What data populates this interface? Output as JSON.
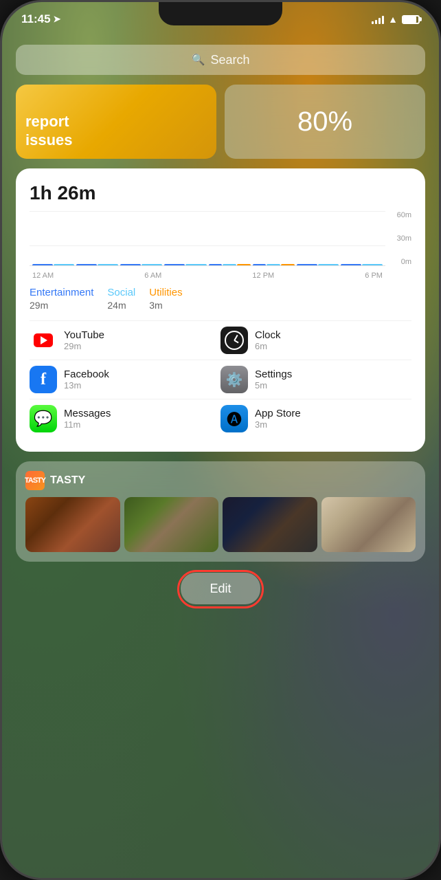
{
  "phone": {
    "time": "11:45",
    "status_bar": {
      "signal_bars": [
        3,
        4,
        5,
        6
      ],
      "battery_percent": 85
    }
  },
  "search_bar": {
    "placeholder": "Search",
    "icon": "search-icon"
  },
  "widgets": {
    "issues": {
      "label": "report\nissues"
    },
    "battery": {
      "value": "80%"
    }
  },
  "screen_time": {
    "total": "1h 26m",
    "chart": {
      "y_labels": [
        "60m",
        "30m",
        "0m"
      ],
      "x_labels": [
        "12 AM",
        "6 AM",
        "12 PM",
        "6 PM"
      ],
      "bars": [
        {
          "height_ent": 0,
          "height_soc": 0,
          "height_util": 0
        },
        {
          "height_ent": 0,
          "height_soc": 0,
          "height_util": 0
        },
        {
          "height_ent": 15,
          "height_soc": 8,
          "height_util": 0
        },
        {
          "height_ent": 25,
          "height_soc": 20,
          "height_util": 0
        },
        {
          "height_ent": 30,
          "height_soc": 18,
          "height_util": 5
        },
        {
          "height_ent": 35,
          "height_soc": 22,
          "height_util": 3
        },
        {
          "height_ent": 20,
          "height_soc": 15,
          "height_util": 0
        },
        {
          "height_ent": 0,
          "height_soc": 0,
          "height_util": 0
        }
      ]
    },
    "categories": [
      {
        "name": "Entertainment",
        "color": "#3478f6",
        "time": "29m"
      },
      {
        "name": "Social",
        "color": "#5ac8fa",
        "time": "24m"
      },
      {
        "name": "Utilities",
        "color": "#ff9500",
        "time": "3m"
      }
    ],
    "apps": [
      {
        "name": "YouTube",
        "time": "29m",
        "icon_type": "youtube",
        "position": "left"
      },
      {
        "name": "Clock",
        "time": "6m",
        "icon_type": "clock",
        "position": "right"
      },
      {
        "name": "Facebook",
        "time": "13m",
        "icon_type": "facebook",
        "position": "left"
      },
      {
        "name": "Settings",
        "time": "5m",
        "icon_type": "settings",
        "position": "right"
      },
      {
        "name": "Messages",
        "time": "11m",
        "icon_type": "messages",
        "position": "left"
      },
      {
        "name": "App Store",
        "time": "3m",
        "icon_type": "appstore",
        "position": "right"
      }
    ]
  },
  "tasty_widget": {
    "brand": "TASTY",
    "logo_text": "T"
  },
  "edit_button": {
    "label": "Edit"
  }
}
